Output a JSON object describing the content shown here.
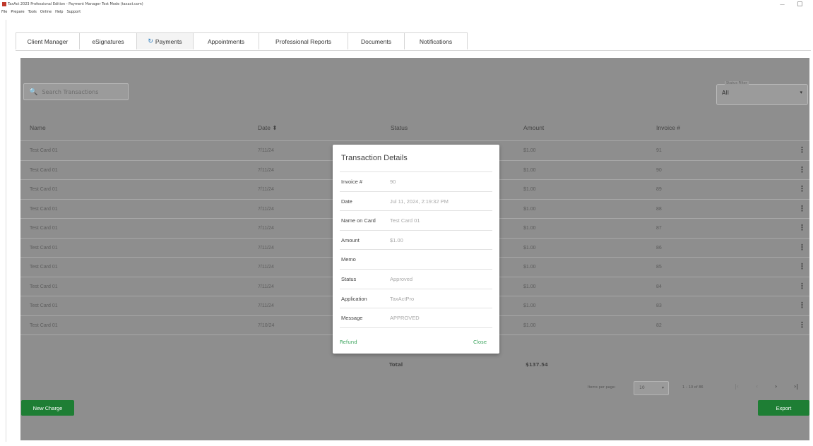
{
  "window": {
    "title": "TaxAct 2023 Professional Edition - Payment Manager Test Mode (taxact.com)",
    "minimize": "—",
    "maximize": "▢"
  },
  "menu": [
    "File",
    "Prepare",
    "Tools",
    "Online",
    "Help",
    "Support"
  ],
  "tabs": [
    {
      "label": "Client Manager"
    },
    {
      "label": "eSignatures"
    },
    {
      "label": "Payments",
      "icon": "refresh-icon",
      "icon_glyph": "↻",
      "active": true
    },
    {
      "label": "Appointments"
    },
    {
      "label": "Professional Reports"
    },
    {
      "label": "Documents"
    },
    {
      "label": "Notifications"
    }
  ],
  "search": {
    "placeholder": "Search Transactions",
    "icon_glyph": "🔍"
  },
  "status_filter": {
    "label": "Status Filter",
    "value": "All",
    "caret": "▾"
  },
  "table": {
    "headers": {
      "name": "Name",
      "date": "Date ⬍",
      "status": "Status",
      "amount": "Amount",
      "invoice": "Invoice #"
    },
    "rows": [
      {
        "name": "Test Card 01",
        "date": "7/11/24",
        "amount": "$1.00",
        "invoice": "91"
      },
      {
        "name": "Test Card 01",
        "date": "7/11/24",
        "amount": "$1.00",
        "invoice": "90"
      },
      {
        "name": "Test Card 01",
        "date": "7/11/24",
        "amount": "$1.00",
        "invoice": "89"
      },
      {
        "name": "Test Card 01",
        "date": "7/11/24",
        "amount": "$1.00",
        "invoice": "88"
      },
      {
        "name": "Test Card 01",
        "date": "7/11/24",
        "amount": "$1.00",
        "invoice": "87"
      },
      {
        "name": "Test Card 01",
        "date": "7/11/24",
        "amount": "$1.00",
        "invoice": "86"
      },
      {
        "name": "Test Card 01",
        "date": "7/11/24",
        "amount": "$1.00",
        "invoice": "85"
      },
      {
        "name": "Test Card 01",
        "date": "7/11/24",
        "amount": "$1.00",
        "invoice": "84"
      },
      {
        "name": "Test Card 01",
        "date": "7/11/24",
        "amount": "$1.00",
        "invoice": "83"
      },
      {
        "name": "Test Card 01",
        "date": "7/10/24",
        "amount": "$1.00",
        "invoice": "82"
      }
    ],
    "kebab": "⋮",
    "total_label": "Total",
    "total_amount": "$137.54"
  },
  "pager": {
    "items_per_page_label": "Items per page:",
    "page_size": "10",
    "caret": "▾",
    "range": "1 – 10 of 86",
    "first": "|‹",
    "prev": "‹",
    "next": "›",
    "last": "›|"
  },
  "buttons": {
    "new_charge": "New Charge",
    "export": "Export"
  },
  "modal": {
    "title": "Transaction Details",
    "fields": [
      {
        "label": "Invoice #",
        "value": "90"
      },
      {
        "label": "Date",
        "value": "Jul 11, 2024, 2:19:32 PM"
      },
      {
        "label": "Name on Card",
        "value": "Test Card 01"
      },
      {
        "label": "Amount",
        "value": "$1.00"
      },
      {
        "label": "Memo",
        "value": ""
      },
      {
        "label": "Status",
        "value": "Approved"
      },
      {
        "label": "Application",
        "value": "TaxActPro"
      },
      {
        "label": "Message",
        "value": "APPROVED"
      }
    ],
    "refund": "Refund",
    "close": "Close"
  },
  "colors": {
    "overlay": "#8e8e8e",
    "primary_green": "#1e7e34",
    "link_green": "#3aa35c",
    "tab_accent": "#2c7dbf"
  }
}
